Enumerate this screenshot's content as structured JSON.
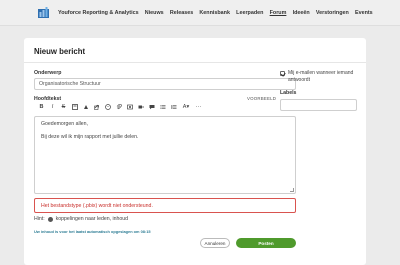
{
  "nav": {
    "items": [
      "Youforce Reporting & Analytics",
      "Nieuws",
      "Releases",
      "Kennisbank",
      "Leerpaden",
      "Forum",
      "Ideeën",
      "Verstoringen",
      "Events"
    ],
    "active": "Forum"
  },
  "page": {
    "title": "Nieuw bericht"
  },
  "form": {
    "subject_label": "Onderwerp",
    "subject_value": "Organisatorische Structuur",
    "body_label": "Hoofdtekst",
    "preview_label": "VOORBEELD",
    "body_lines": [
      "Goedemorgen allen,",
      "Bij deze wil ik mijn rapport met jullie delen."
    ],
    "error": "Het bestandstype (.pbix) wordt niet ondersteund.",
    "hint_prefix": "Hint:",
    "hint_text": "koppelingen naar leden, inhoud",
    "autosave": "Uw inhoud is voor het laatst automatisch opgeslagen om 08:15",
    "cancel_label": "Annuleren",
    "post_label": "Posten"
  },
  "sidebar": {
    "notify_label": "Mij e-mailen wanneer iemand antwoordt",
    "notify_checked": true,
    "labels_title": "Labels"
  },
  "toolbar_icons": [
    "bold-icon",
    "italic-icon",
    "strikethrough-icon",
    "heading-icon",
    "highlight-icon",
    "link-icon",
    "emoji-icon",
    "attachment-icon",
    "image-icon",
    "video-icon",
    "quote-icon",
    "bulleted-list-icon",
    "numbered-list-icon",
    "text-color-icon",
    "more-icon"
  ],
  "colors": {
    "accent_green": "#4f9a2c",
    "error_red": "#d9534f",
    "autosave_blue": "#2e7d95"
  }
}
